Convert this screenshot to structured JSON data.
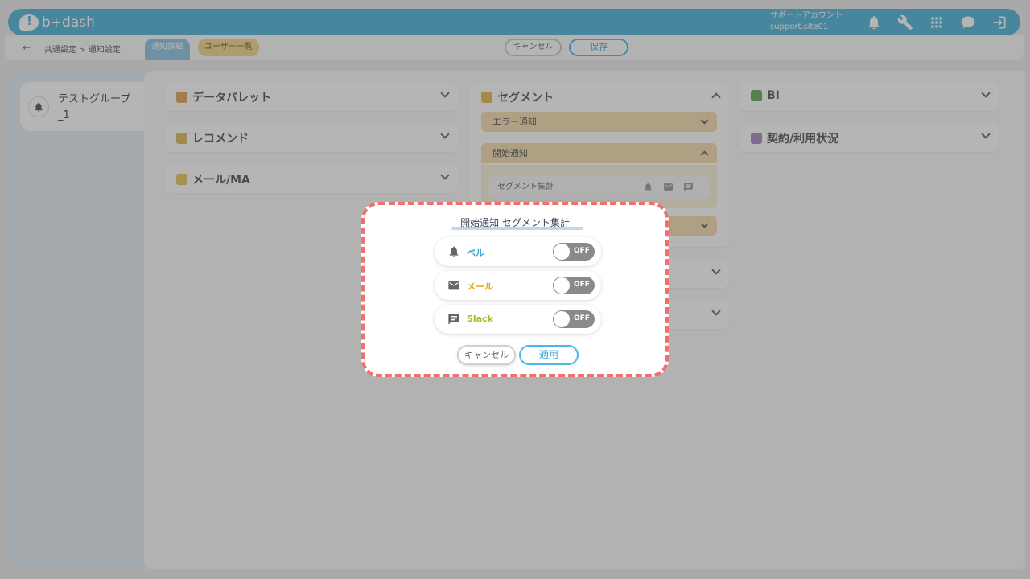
{
  "header": {
    "logo_text": "b+dash",
    "account_name": "サポートアカウント",
    "account_site": "support.site01",
    "icons": [
      "bell-icon",
      "wrench-icon",
      "apps-grid-icon",
      "chat-icon",
      "logout-icon"
    ],
    "color": "#4fb3d8"
  },
  "subbar": {
    "back_label": "←",
    "breadcrumb": "共通設定 > 通知設定",
    "tabs": [
      {
        "label": "通知詳細",
        "active": true
      },
      {
        "label": "ユーザー一覧",
        "active": false
      }
    ],
    "cancel_label": "キャンセル",
    "save_label": "保存"
  },
  "sidebar": {
    "group_name": "テストグループ_1"
  },
  "cards": {
    "datapalette": "データパレット",
    "recommend": "レコメンド",
    "mail_ma": "メール/MA",
    "segment": "セグメント",
    "bi": "BI",
    "contract": "契約/利用状況"
  },
  "segment": {
    "error_notice": "エラー通知",
    "start_notice": "開始通知",
    "item": "セグメント集計"
  },
  "modal": {
    "title": "開始通知 セグメント集計",
    "rows": [
      {
        "label": "ベル",
        "icon": "bell-icon",
        "state": "OFF",
        "color": "#3aa6d8"
      },
      {
        "label": "メール",
        "icon": "mail-icon",
        "state": "OFF",
        "color": "#e8a800"
      },
      {
        "label": "Slack",
        "icon": "slack-message-icon",
        "state": "OFF",
        "color": "#9cc21e"
      }
    ],
    "cancel_label": "キャンセル",
    "apply_label": "適用",
    "border_color": "#f07070"
  }
}
